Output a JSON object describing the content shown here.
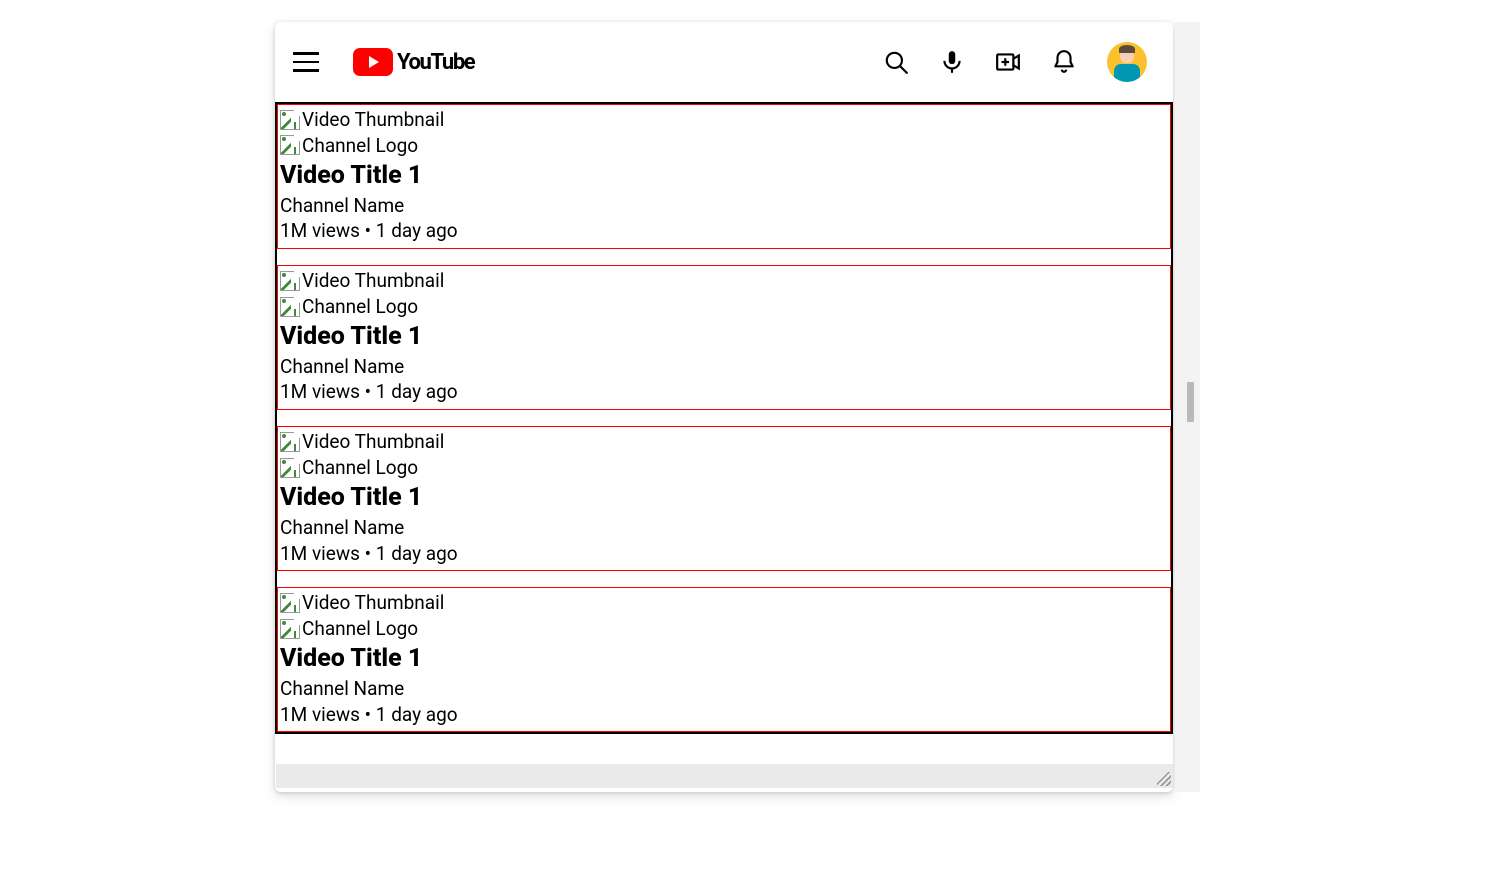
{
  "brand": {
    "name": "YouTube"
  },
  "altText": {
    "thumbnail": "Video Thumbnail",
    "channelLogo": "Channel Logo"
  },
  "videos": [
    {
      "title": "Video Title 1",
      "channel": "Channel Name",
      "meta": "1M views • 1 day ago"
    },
    {
      "title": "Video Title 1",
      "channel": "Channel Name",
      "meta": "1M views • 1 day ago"
    },
    {
      "title": "Video Title 1",
      "channel": "Channel Name",
      "meta": "1M views • 1 day ago"
    },
    {
      "title": "Video Title 1",
      "channel": "Channel Name",
      "meta": "1M views • 1 day ago"
    }
  ]
}
